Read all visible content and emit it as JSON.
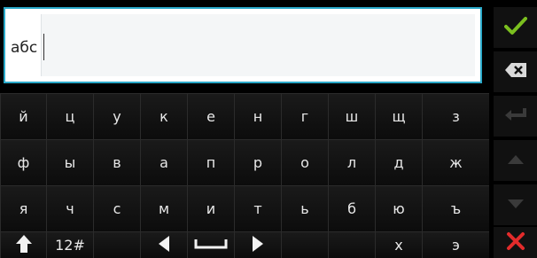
{
  "input": {
    "value": "абс"
  },
  "keys": {
    "row1": [
      "й",
      "ц",
      "у",
      "к",
      "е",
      "н",
      "г",
      "ш",
      "щ",
      "з"
    ],
    "row2": [
      "ф",
      "ы",
      "в",
      "а",
      "п",
      "р",
      "о",
      "л",
      "д",
      "ж"
    ],
    "row3": [
      "я",
      "ч",
      "с",
      "м",
      "и",
      "т",
      "ь",
      "б",
      "ю",
      "ъ"
    ],
    "row4": {
      "numbers_label": "12#",
      "x_label": "х",
      "e_label": "э"
    }
  },
  "icons": {
    "confirm": "check-icon",
    "backspace": "backspace-icon",
    "enter": "enter-icon",
    "up": "up-arrow-icon",
    "down": "down-arrow-icon",
    "close": "close-icon",
    "shift": "shift-icon",
    "left": "left-arrow-icon",
    "space": "space-icon",
    "right": "right-arrow-icon"
  },
  "colors": {
    "accent_border": "#2aa9c9",
    "confirm_green": "#7bbf1f",
    "close_red": "#e32b2b"
  }
}
